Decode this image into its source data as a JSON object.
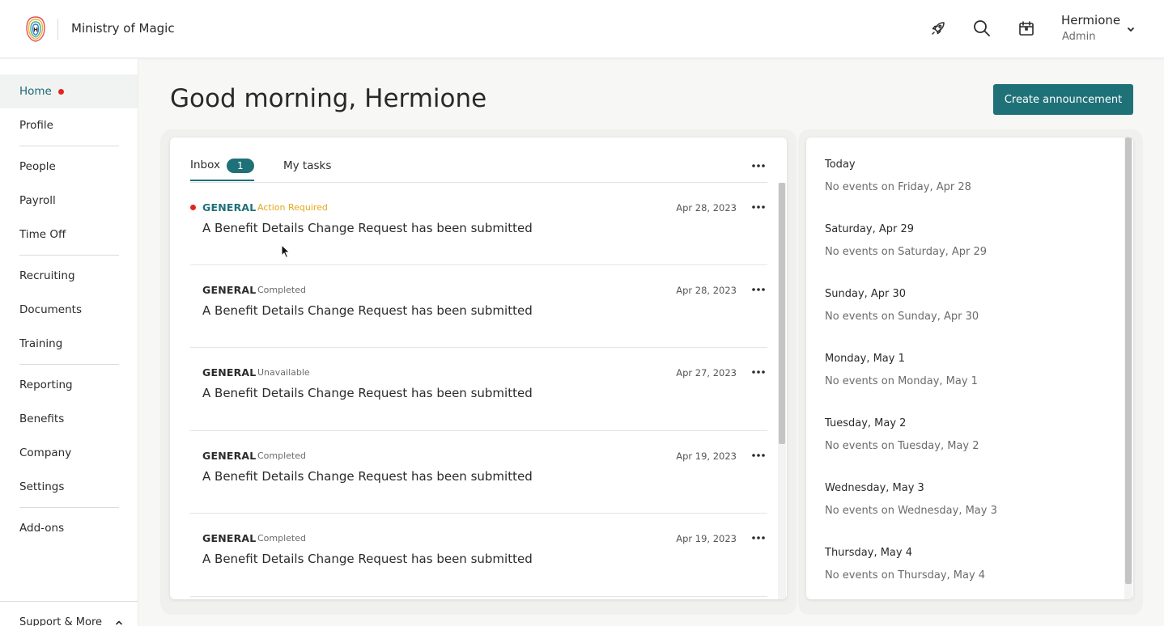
{
  "header": {
    "app_title": "Ministry of Magic",
    "logo_icon": "ministry-logo",
    "icons": [
      "rocket-icon",
      "search-icon",
      "calendar-icon"
    ],
    "user": {
      "name": "Hermione",
      "role": "Admin"
    }
  },
  "sidebar": {
    "items": [
      {
        "label": "Home",
        "active": true,
        "dot": true
      },
      {
        "label": "Profile"
      },
      {
        "label": "People"
      },
      {
        "label": "Payroll"
      },
      {
        "label": "Time Off"
      },
      {
        "label": "Recruiting"
      },
      {
        "label": "Documents"
      },
      {
        "label": "Training"
      },
      {
        "label": "Reporting"
      },
      {
        "label": "Benefits"
      },
      {
        "label": "Company"
      },
      {
        "label": "Settings"
      },
      {
        "label": "Add-ons"
      }
    ],
    "support_label": "Support & More"
  },
  "main": {
    "greeting": "Good morning, Hermione",
    "create_button": "Create announcement",
    "inbox": {
      "tabs": [
        {
          "label": "Inbox",
          "count": "1"
        },
        {
          "label": "My tasks"
        }
      ],
      "items": [
        {
          "category": "GENERAL",
          "status": "Action Required",
          "date": "Apr 28, 2023",
          "title": "A Benefit Details Change Request has been submitted",
          "unread": true
        },
        {
          "category": "GENERAL",
          "status": "Completed",
          "date": "Apr 28, 2023",
          "title": "A Benefit Details Change Request has been submitted"
        },
        {
          "category": "GENERAL",
          "status": "Unavailable",
          "date": "Apr 27, 2023",
          "title": "A Benefit Details Change Request has been submitted"
        },
        {
          "category": "GENERAL",
          "status": "Completed",
          "date": "Apr 19, 2023",
          "title": "A Benefit Details Change Request has been submitted"
        },
        {
          "category": "GENERAL",
          "status": "Completed",
          "date": "Apr 19, 2023",
          "title": "A Benefit Details Change Request has been submitted"
        }
      ]
    },
    "calendar": {
      "days": [
        {
          "name": "Today",
          "events": "No events on Friday, Apr 28"
        },
        {
          "name": "Saturday, Apr 29",
          "events": "No events on Saturday, Apr 29"
        },
        {
          "name": "Sunday, Apr 30",
          "events": "No events on Sunday, Apr 30"
        },
        {
          "name": "Monday, May 1",
          "events": "No events on Monday, May 1"
        },
        {
          "name": "Tuesday, May 2",
          "events": "No events on Tuesday, May 2"
        },
        {
          "name": "Wednesday, May 3",
          "events": "No events on Wednesday, May 3"
        },
        {
          "name": "Thursday, May 4",
          "events": "No events on Thursday, May 4"
        }
      ]
    }
  },
  "colors": {
    "accent": "#1f7178",
    "alert_red": "#e2261f",
    "warning_yellow": "#e6a619"
  }
}
